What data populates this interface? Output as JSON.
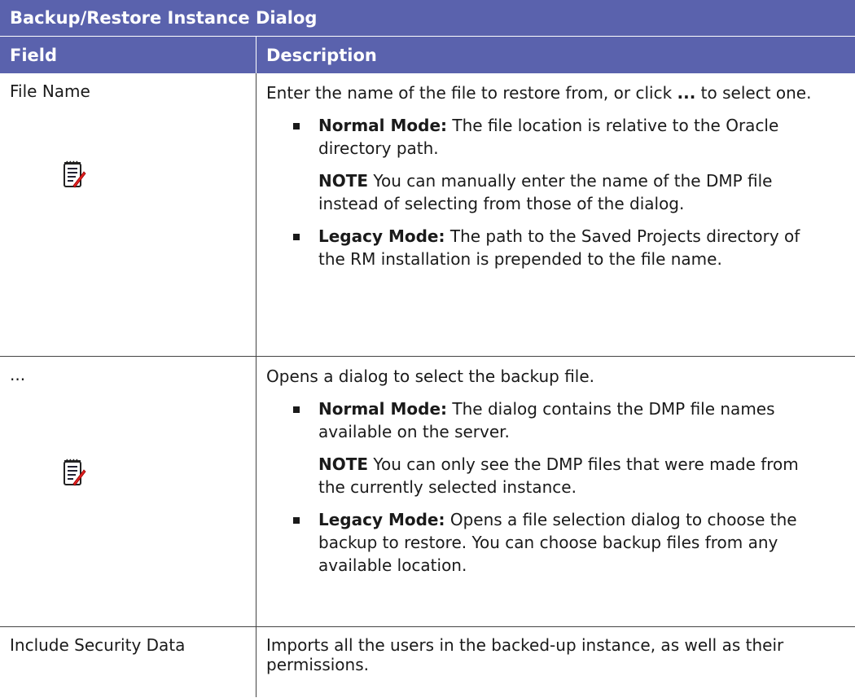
{
  "table": {
    "title": "Backup/Restore Instance Dialog",
    "headers": {
      "field": "Field",
      "description": "Description"
    },
    "rows": [
      {
        "field": "File Name",
        "intro_pre": "Enter the name of the file to restore from, or click ",
        "intro_bold": "...",
        "intro_post": " to select one.",
        "bullet1_label": "Normal Mode:",
        "bullet1_text": " The file location is relative to the Oracle directory path.",
        "note_label": "NOTE",
        "note_text": " You can manually enter the name of the DMP file instead of selecting from those of the dialog.",
        "bullet2_label": "Legacy Mode:",
        "bullet2_text": " The path to the Saved Projects directory of the RM installation is prepended to the file name.",
        "icon": "note-icon"
      },
      {
        "field": "...",
        "intro": "Opens a dialog to select the backup file.",
        "bullet1_label": "Normal Mode:",
        "bullet1_text": " The dialog contains the DMP file names available on the server.",
        "note_label": "NOTE",
        "note_text": " You can only see the DMP files that were made from the currently selected instance.",
        "bullet2_label": "Legacy Mode:",
        "bullet2_text": " Opens a file selection dialog to choose the backup to restore. You can choose backup files from any available location.",
        "icon": "note-icon"
      },
      {
        "field": "Include Security Data",
        "intro": "Imports all the users in the backed-up instance, as well as their permissions."
      }
    ]
  },
  "colors": {
    "header_bg": "#5a62ad",
    "header_text": "#ffffff",
    "border": "#444444"
  }
}
